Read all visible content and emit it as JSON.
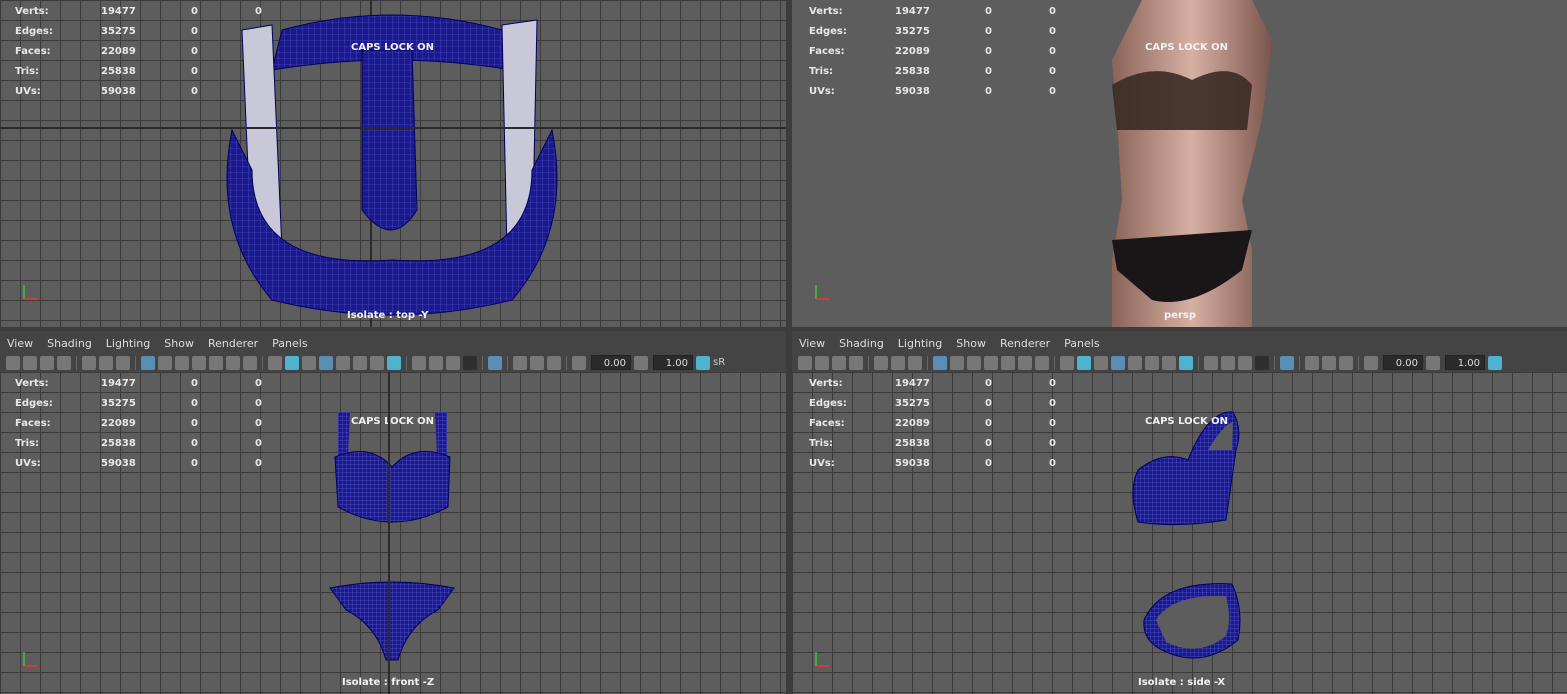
{
  "hud": {
    "labels": [
      "Verts:",
      "Edges:",
      "Faces:",
      "Tris:",
      "UVs:"
    ],
    "values": [
      "19477",
      "35275",
      "22089",
      "25838",
      "59038"
    ],
    "zero": "0"
  },
  "caps_lock": "CAPS LOCK ON",
  "viewports": {
    "top": "Isolate : top -Y",
    "persp": "persp",
    "front": "Isolate : front -Z",
    "side": "Isolate : side -X"
  },
  "menu": [
    "View",
    "Shading",
    "Lighting",
    "Show",
    "Renderer",
    "Panels"
  ],
  "toolbar": {
    "field1": "0.00",
    "field2": "1.00",
    "srgb": "sR"
  },
  "colors": {
    "viewport_bg": "#5d5d5d",
    "wire": "#101088",
    "toolbar_active": "#5a8fb5"
  }
}
